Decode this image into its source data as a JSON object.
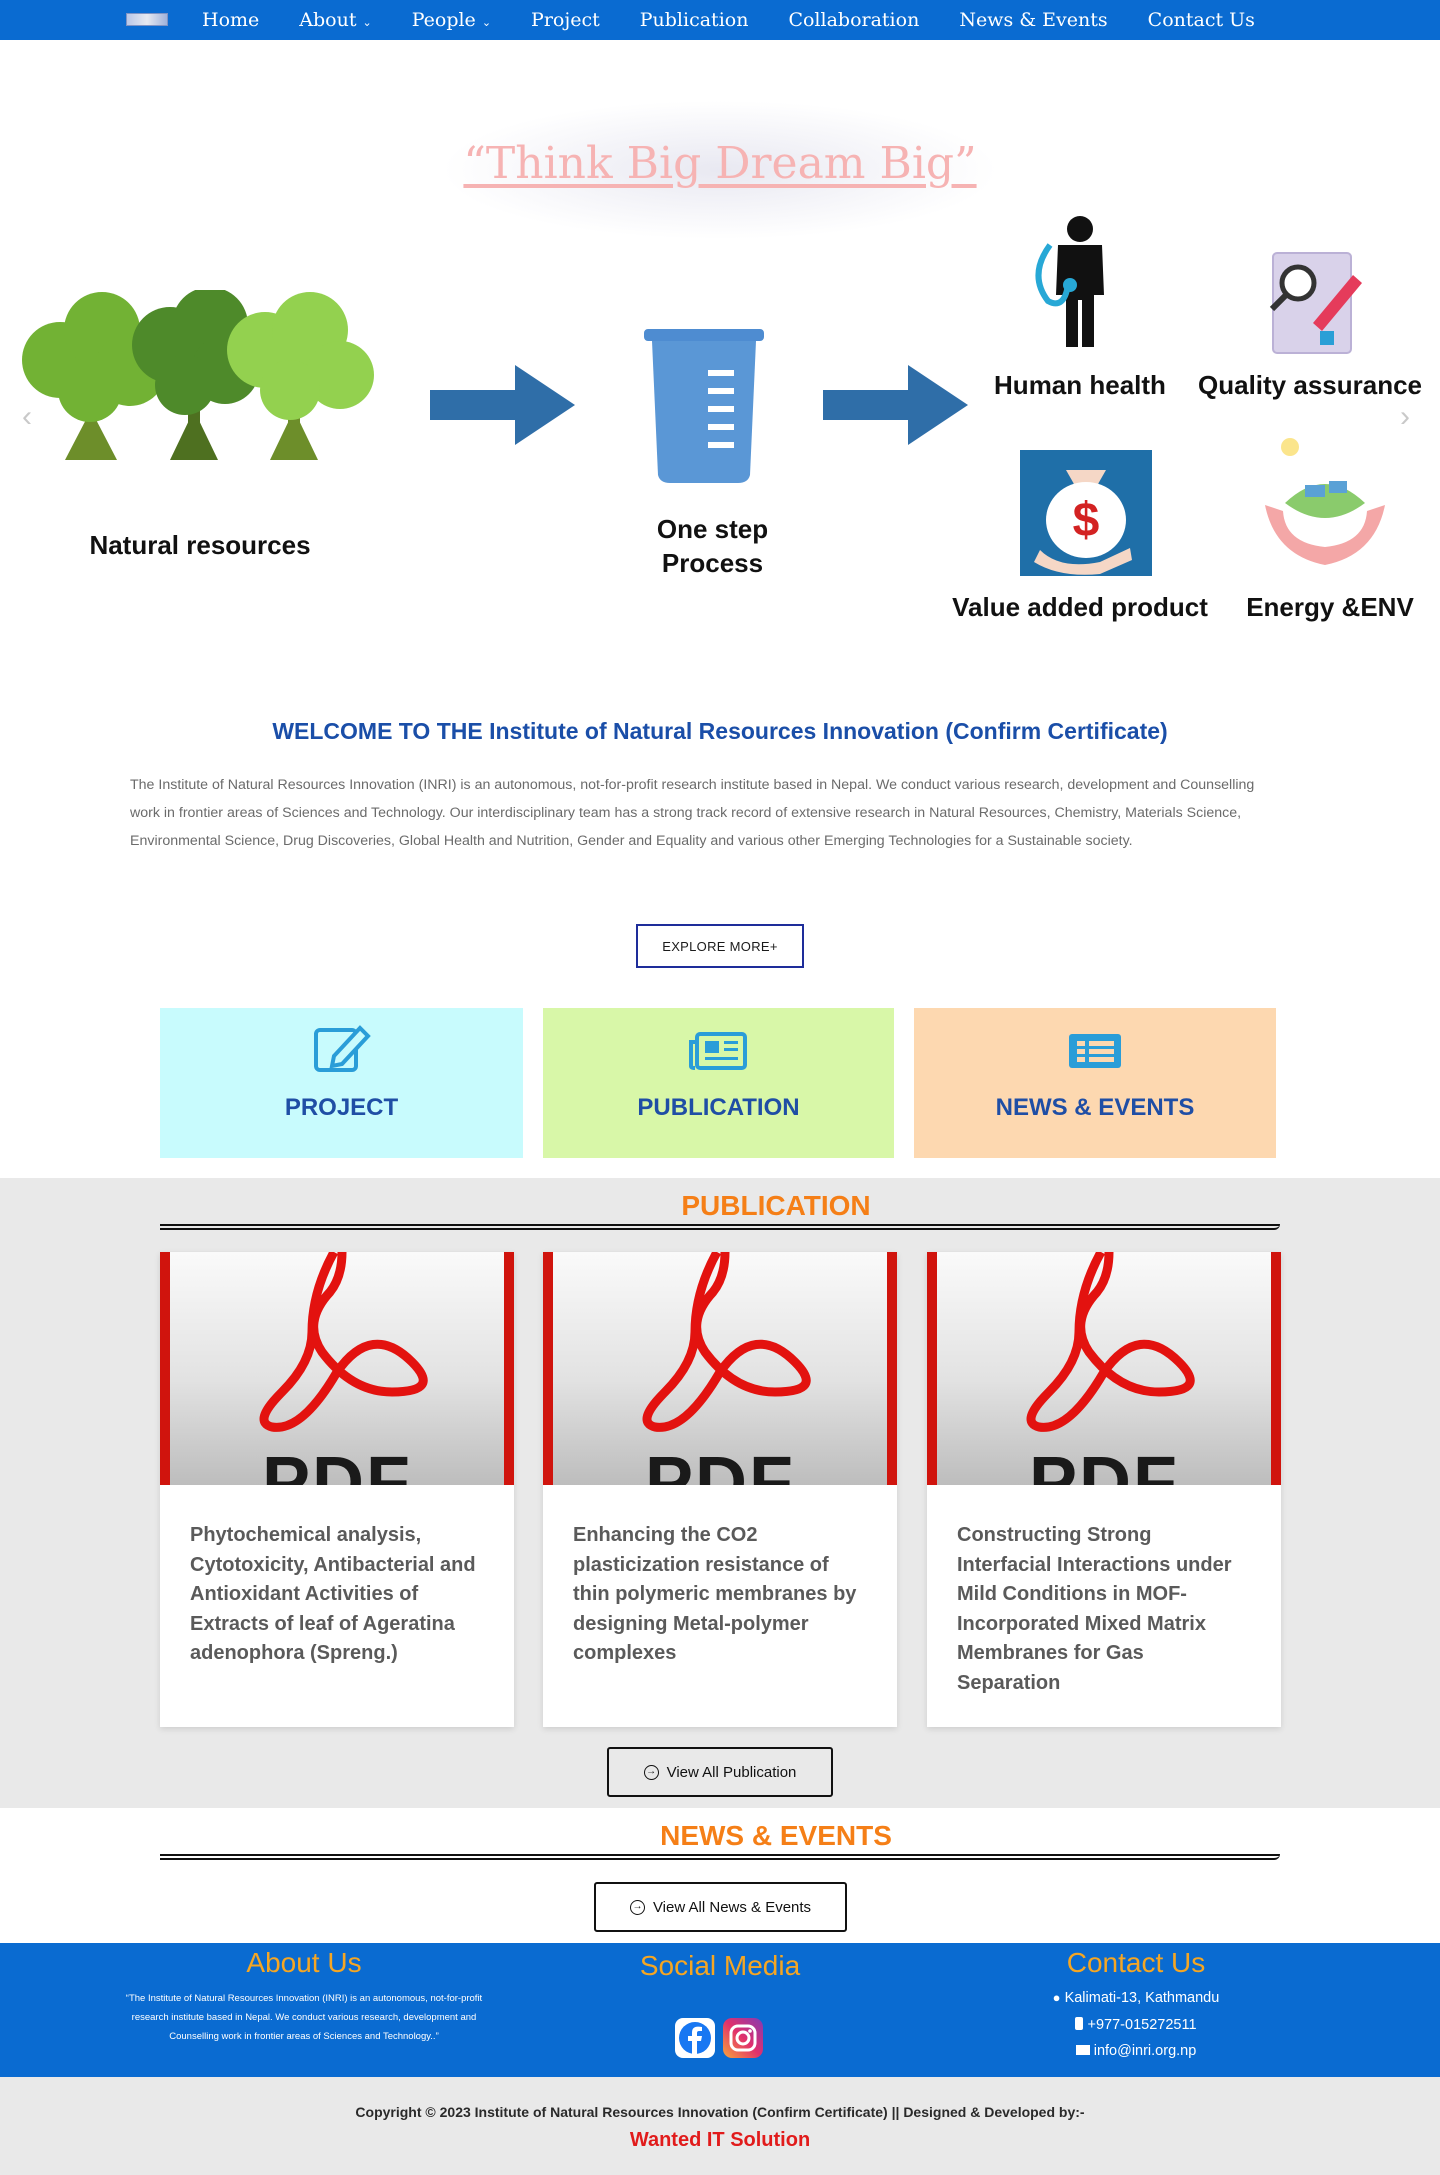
{
  "nav": {
    "items": [
      {
        "label": "Home",
        "dropdown": false
      },
      {
        "label": "About",
        "dropdown": true
      },
      {
        "label": "People",
        "dropdown": true
      },
      {
        "label": "Project",
        "dropdown": false
      },
      {
        "label": "Publication",
        "dropdown": false
      },
      {
        "label": "Collaboration",
        "dropdown": false
      },
      {
        "label": "News & Events",
        "dropdown": false
      },
      {
        "label": "Contact Us",
        "dropdown": false
      }
    ],
    "chevron": "⌄"
  },
  "hero": {
    "slogan": "“Think Big Dream Big”",
    "labels": {
      "natural": "Natural resources",
      "process_1": "One step",
      "process_2": "Process",
      "health": "Human health",
      "quality": "Quality assurance",
      "value": "Value added product",
      "energy": "Energy &ENV"
    },
    "prev": "‹",
    "next": "›"
  },
  "welcome": {
    "title": "WELCOME TO THE Institute of Natural Resources Innovation (Confirm Certificate)",
    "text": "The Institute of Natural Resources Innovation (INRI) is an autonomous, not-for-profit research  institute based in Nepal. We conduct various research, development and Counselling work in frontier areas of Sciences and Technology. Our interdisciplinary team has a strong track record of extensive research in Natural Resources, Chemistry, Materials Science, Environmental Science, Drug Discoveries, Global Health and Nutrition, Gender and Equality and various other Emerging Technologies for a Sustainable society.",
    "button": "EXPLORE MORE+"
  },
  "features": [
    {
      "label": "PROJECT",
      "bg": "#c8fbfd",
      "icon": "edit-icon"
    },
    {
      "label": "PUBLICATION",
      "bg": "#d8f7a8",
      "icon": "newspaper-icon"
    },
    {
      "label": "NEWS & EVENTS",
      "bg": "#fdd8b0",
      "icon": "news-list-icon"
    }
  ],
  "publication": {
    "title": "PUBLICATION",
    "thumb_text": "PDF",
    "cards": [
      {
        "title": "Phytochemical analysis, Cytotoxicity, Antibacterial and Antioxidant Activities of Extracts of leaf of Ageratina adenophora (Spreng.)"
      },
      {
        "title": "Enhancing the CO2 plasticization resistance of thin polymeric membranes by designing Metal-polymer complexes"
      },
      {
        "title": "Constructing Strong Interfacial Interactions under Mild Conditions in MOF-Incorporated Mixed Matrix Membranes for Gas Separation"
      }
    ],
    "button": "View All Publication"
  },
  "news": {
    "title": "NEWS & EVENTS",
    "button": "View All News & Events"
  },
  "footer": {
    "about_title": "About Us",
    "about_text": "“The Institute of Natural Resources Innovation (INRI) is an autonomous, not-for-profit research institute based in Nepal. We conduct various research, development and Counselling work in frontier areas of Sciences and Technology..”",
    "social_title": "Social Media",
    "contact_title": "Contact Us",
    "address": "Kalimati-13, Kathmandu",
    "phone": "+977-015272511",
    "email": "info@inri.org.np",
    "copyright": "Copyright © 2023 Institute of Natural Resources Innovation (Confirm Certificate) || Designed & Developed by:-",
    "developer": "Wanted IT Solution"
  },
  "colors": {
    "nav_bg": "#0a6bd1",
    "title_blue": "#1a4ea8",
    "orange": "#f57f17",
    "footer_heading": "#f5a623",
    "developer_red": "#e11b1b"
  }
}
